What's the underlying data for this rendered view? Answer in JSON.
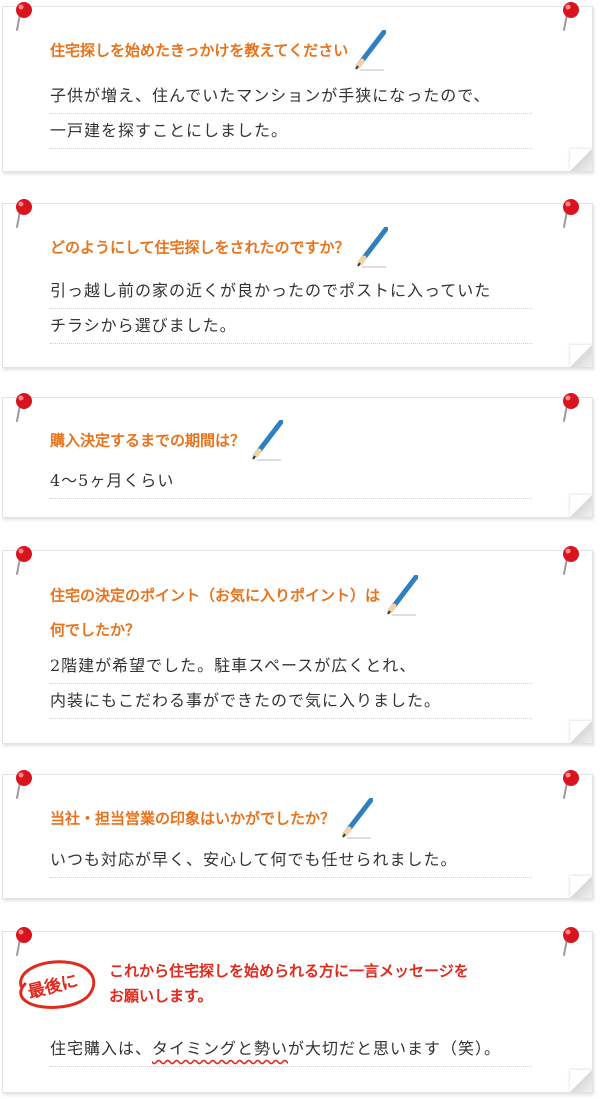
{
  "colors": {
    "question": "#e8731d",
    "last_question": "#e02a1d",
    "pin": "#d8141f",
    "pencil": "#2f7fc1"
  },
  "cards": [
    {
      "question": "住宅探しを始めたきっかけを教えてください",
      "answer_lines": [
        "子供が増え、住んでいたマンションが手狭になったので、",
        "一戸建を探すことにしました。"
      ]
    },
    {
      "question": "どのようにして住宅探しをされたのですか？",
      "answer_lines": [
        "引っ越し前の家の近くが良かったのでポストに入っていた",
        "チラシから選びました。"
      ]
    },
    {
      "question": "購入決定するまでの期間は？",
      "answer_lines": [
        "4〜5ヶ月くらい"
      ]
    },
    {
      "question_line1": "住宅の決定のポイント（お気に入りポイント）は",
      "question_line2": "何でしたか？",
      "answer_lines": [
        "2階建が希望でした。駐車スペースが広くとれ、",
        "内装にもこだわる事ができたので気に入りました。"
      ]
    },
    {
      "question": "当社・担当営業の印象はいかがでしたか？",
      "answer_lines": [
        "いつも対応が早く、安心して何でも任せられました。"
      ]
    }
  ],
  "last": {
    "badge": "最後に",
    "question_line1": "これから住宅探しを始められる方に一言メッセージを",
    "question_line2": "お願いします。",
    "answer_part1": "住宅購入は、",
    "answer_highlight": "タイミングと勢い",
    "answer_part2": "が大切だと思います（笑）。"
  }
}
